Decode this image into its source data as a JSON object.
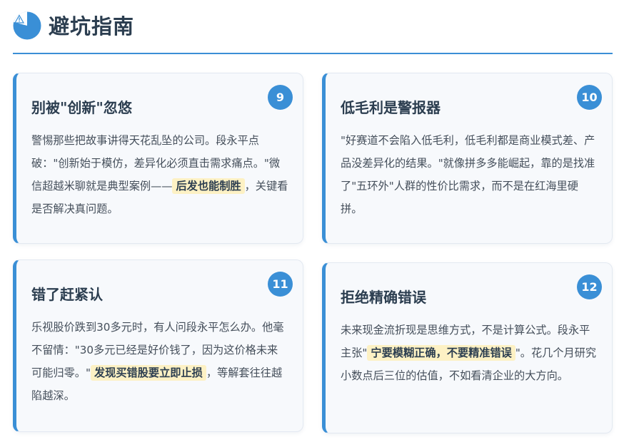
{
  "header": {
    "title": "避坑指南",
    "icon": "warning-clock-icon",
    "accent": "#3a8fd6"
  },
  "cards": [
    {
      "number": "9",
      "title": "别被\"创新\"忽悠",
      "body_before": "警惕那些把故事讲得天花乱坠的公司。段永平点破：\"创新始于模仿，差异化必须直击需求痛点。\"微信超越米聊就是典型案例——",
      "highlight": "后发也能制胜",
      "body_after": "，关键看是否解决真问题。"
    },
    {
      "number": "10",
      "title": "低毛利是警报器",
      "body_before": "\"好赛道不会陷入低毛利，低毛利都是商业模式差、产品没差异化的结果。\"就像拼多多能崛起，靠的是找准了\"五环外\"人群的性价比需求，而不是在红海里硬拼。",
      "highlight": "",
      "body_after": ""
    },
    {
      "number": "11",
      "title": "错了赶紧认",
      "body_before": "乐视股价跌到30多元时，有人问段永平怎么办。他毫不留情：\"30多元已经是好价钱了，因为这价格未来可能归零。\"",
      "highlight": "发现买错股要立即止损",
      "body_after": "，等解套往往越陷越深。"
    },
    {
      "number": "12",
      "title": "拒绝精确错误",
      "body_before": "未来现金流折现是思维方式，不是计算公式。段永平主张\"",
      "highlight": "宁要模糊正确，不要精准错误",
      "body_after": "\"。花几个月研究小数点后三位的估值，不如看清企业的大方向。"
    }
  ]
}
